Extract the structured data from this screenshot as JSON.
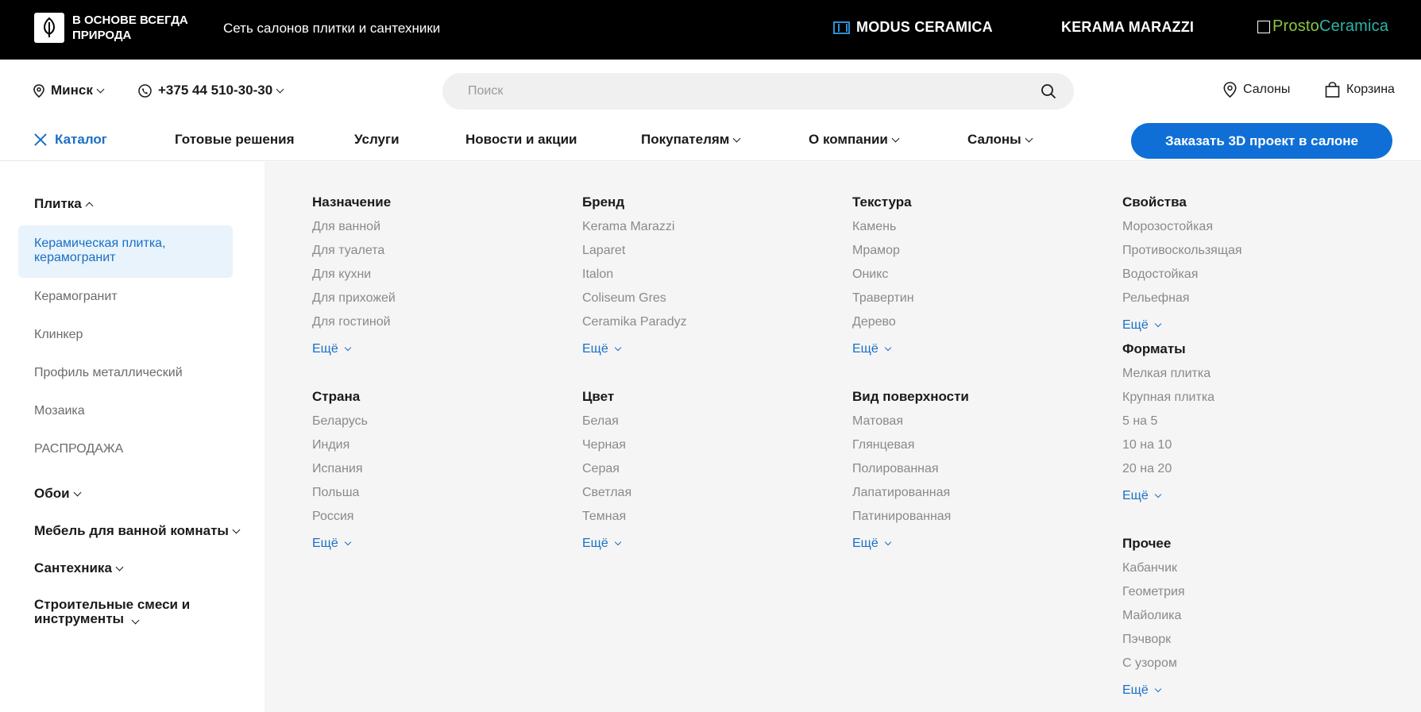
{
  "topbar": {
    "logo_text": "В ОСНОВЕ ВСЕГДА ПРИРОДА",
    "network": "Сеть салонов плитки и сантехники",
    "brands": {
      "modus": "MODUS CERAMICA",
      "kerama": "KERAMA MARAZZI",
      "prosto_a": "Prosto",
      "prosto_b": "Ceramica"
    }
  },
  "header": {
    "city": "Минск",
    "phone": "+375 44 510-30-30",
    "search_placeholder": "Поиск",
    "salons": "Салоны",
    "cart": "Корзина"
  },
  "nav": {
    "catalog": "Каталог",
    "items": [
      "Готовые решения",
      "Услуги",
      "Новости и акции",
      "Покупателям",
      "О компании",
      "Салоны"
    ],
    "cta": "Заказать 3D проект в салоне"
  },
  "sidebar": {
    "tile": "Плитка",
    "active": "Керамическая плитка, керамогранит",
    "subs": [
      "Керамогранит",
      "Клинкер",
      "Профиль металлический",
      "Мозаика",
      "РАСПРОДАЖА"
    ],
    "categories": [
      "Обои",
      "Мебель для ванной комнаты",
      "Сантехника",
      "Строительные смеси и инструменты"
    ]
  },
  "more_label": "Ещё",
  "panel": {
    "groups": [
      {
        "title": "Назначение",
        "items": [
          "Для ванной",
          "Для туалета",
          "Для кухни",
          "Для прихожей",
          "Для гостиной"
        ]
      },
      {
        "title": "Страна",
        "items": [
          "Беларусь",
          "Индия",
          "Испания",
          "Польша",
          "Россия"
        ]
      },
      {
        "title": "Бренд",
        "items": [
          "Kerama Marazzi",
          "Laparet",
          "Italon",
          "Coliseum Gres",
          "Ceramika Paradyz"
        ]
      },
      {
        "title": "Цвет",
        "items": [
          "Белая",
          "Черная",
          "Серая",
          "Светлая",
          "Темная"
        ]
      },
      {
        "title": "Текстура",
        "items": [
          "Камень",
          "Мрамор",
          "Оникс",
          "Травертин",
          "Дерево"
        ]
      },
      {
        "title": "Вид поверхности",
        "items": [
          "Матовая",
          "Глянцевая",
          "Полированная",
          "Лапатированная",
          "Патинированная"
        ]
      },
      {
        "title": "Свойства",
        "items": [
          "Морозостойкая",
          "Противоскользящая",
          "Водостойкая",
          "Рельефная"
        ]
      },
      {
        "title": "Форматы",
        "items": [
          "Мелкая плитка",
          "Крупная плитка",
          "5 на 5",
          "10 на 10",
          "20 на 20"
        ]
      },
      {
        "title": "Прочее",
        "items": [
          "Кабанчик",
          "Геометрия",
          "Майолика",
          "Пэчворк",
          "С узором"
        ]
      }
    ]
  }
}
